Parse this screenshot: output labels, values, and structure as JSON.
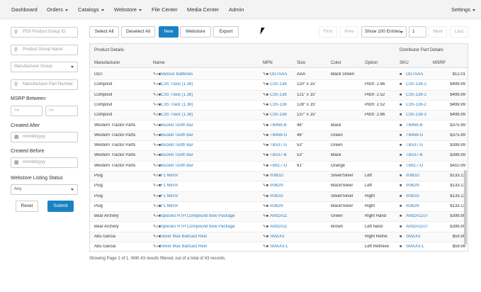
{
  "nav": {
    "dashboard": "Dashboard",
    "orders": "Orders",
    "catalogs": "Catalogs",
    "webstore": "Webstore",
    "file_center": "File Center",
    "media_center": "Media Center",
    "admin": "Admin",
    "settings": "Settings"
  },
  "filters": {
    "pss_group_id": "PSS Product Group ID",
    "group_name": "Product Group Name",
    "manufacturer_group": "Manufacturer Group",
    "manufacturer_part_number": "Manufacturer Part Number",
    "msrp_between_label": "MSRP Between",
    "msrp_min": ">=",
    "msrp_max": "<=",
    "created_after_label": "Created After",
    "created_after": "mm/dd/yyyy",
    "created_before_label": "Created Before",
    "created_before": "mm/dd/yyyy",
    "listing_status_label": "Webstore Listing Status",
    "listing_status": "Any",
    "reset": "Reset",
    "submit": "Submit"
  },
  "toolbar": {
    "select_all": "Select All",
    "deselect_all": "Deselect All",
    "new": "New",
    "webstore": "Webstore",
    "export": "Export",
    "first": "First",
    "prev": "Prev",
    "page_size": "Show 100 Entries",
    "page": "1",
    "next": "Next",
    "last": "Last"
  },
  "grid": {
    "group1": "Product Details",
    "group2": "Distributor Part Details",
    "columns": [
      "Manufacturer",
      "Name",
      "MPN",
      "Size",
      "Color",
      "Option",
      "SKU",
      "MSRP"
    ],
    "rows": [
      [
        "ODT",
        "Various Batteries",
        "ODTAAA",
        "AAA",
        "Black Green",
        "",
        "ODTAAA",
        "$12.01"
      ],
      [
        "Composit",
        "C3S Track (1.38)",
        "C3S-138",
        "120\" x 15\"",
        "",
        "Pitch: 2.86",
        "C3S-138-2",
        "$499.99"
      ],
      [
        "Composit",
        "C3S Track (1.38)",
        "C3S-138",
        "121\" x 15\"",
        "",
        "Pitch: 2.52",
        "C3S-138-2",
        "$499.99"
      ],
      [
        "Composit",
        "C3S Track (1.38)",
        "C3S-138",
        "128\" x 15\"",
        "",
        "Pitch: 2.52",
        "C3S-138-2",
        "$499.99"
      ],
      [
        "Composit",
        "C3S Track (1.38)",
        "C3S-138",
        "137\" x 15\"",
        "",
        "Pitch: 2.86",
        "C3S-138-3",
        "$499.99"
      ],
      [
        "Western Tractor Parts",
        "Bucket Tooth Bar",
        "TB466-B",
        "46\"",
        "Black",
        "",
        "TB466-B",
        "$375.99"
      ],
      [
        "Western Tractor Parts",
        "Bucket Tooth Bar",
        "TB466-G",
        "46\"",
        "Green",
        "",
        "TB466-G",
        "$375.99"
      ],
      [
        "Western Tractor Parts",
        "Bucket Tooth Bar",
        "TB537-G",
        "53\"",
        "Green",
        "",
        "TB537-G",
        "$399.99"
      ],
      [
        "Western Tractor Parts",
        "Bucket Tooth Bar",
        "TB537-B",
        "53\"",
        "Black",
        "",
        "TB537-B",
        "$399.99"
      ],
      [
        "Western Tractor Parts",
        "Bucket Tooth Bar",
        "TB617-O",
        "61\"",
        "Orange",
        "",
        "TB617-O",
        "$410.99"
      ],
      [
        "Puig",
        "F1 Mirror",
        "008DD",
        "",
        "Silver/Silver",
        "Left",
        "008DD",
        "$133.13"
      ],
      [
        "Puig",
        "F1 Mirror",
        "008DN",
        "",
        "Black/Silver",
        "Left",
        "008DN",
        "$133.13"
      ],
      [
        "Puig",
        "F1 Mirror",
        "009DD",
        "",
        "Silver/Silver",
        "Right",
        "009DD",
        "$133.13"
      ],
      [
        "Puig",
        "F1 Mirror",
        "009DN",
        "",
        "Black/Silver",
        "Right",
        "009DN",
        "$133.13"
      ],
      [
        "Bear Archery",
        "Species RTH Compound Bow Package",
        "AV82A11",
        "",
        "Green",
        "Right Hand",
        "AV82A1107",
        "$399.99"
      ],
      [
        "Bear Archery",
        "Species RTH Compound Bow Package",
        "AV82A11",
        "",
        "Brown",
        "Left hand",
        "AV82A1107",
        "$399.99"
      ],
      [
        "Abu Garcia",
        "Silver Max Baitcast Reel",
        "SMAX3",
        "",
        "",
        "Right Retrie",
        "SMAX3",
        "$59.99"
      ],
      [
        "Abu Garcia",
        "Silver Max Baitcast Reel",
        "SMAX3-L",
        "",
        "",
        "Left Retrieve",
        "SMAX3-L",
        "$59.99"
      ]
    ]
  },
  "footer": "Showing Page 1 of 1. With 43 results filtered, out of a total of 43 records."
}
